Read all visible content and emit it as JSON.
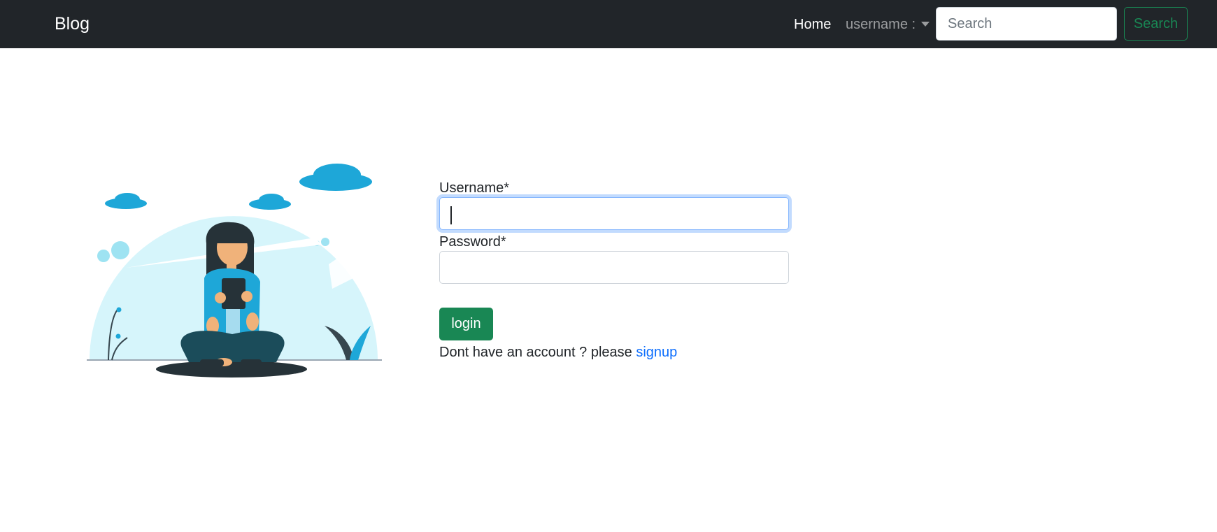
{
  "navbar": {
    "brand": "Blog",
    "home_label": "Home",
    "user_menu_label": "username :",
    "search_placeholder": "Search",
    "search_button_label": "Search"
  },
  "login_form": {
    "username_label": "Username*",
    "username_value": "",
    "password_label": "Password*",
    "password_value": "",
    "login_button_label": "login",
    "signup_prompt": "Dont have an account ? please",
    "signup_link_label": "signup"
  },
  "colors": {
    "navbar_bg": "#212529",
    "success": "#198754",
    "link": "#0d6efd",
    "illustration_accent": "#1ea7d8",
    "illustration_light": "#d6f5fb"
  }
}
